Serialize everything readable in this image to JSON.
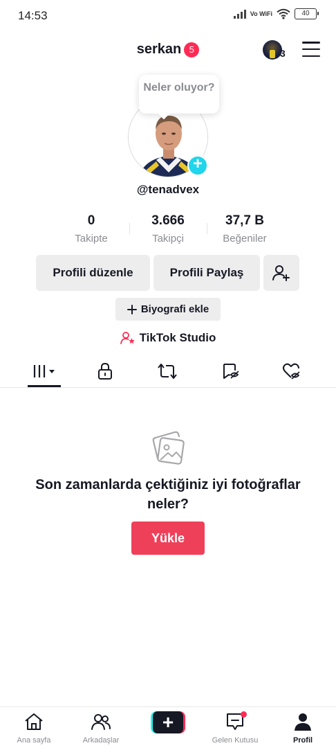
{
  "status_bar": {
    "time": "14:53",
    "network": "Vo WiFi",
    "battery": "40"
  },
  "header": {
    "username": "serkan",
    "notification_count": "5",
    "account_switch_count": "3"
  },
  "profile": {
    "note_bubble": "Neler oluyor?",
    "handle": "@tenadvex"
  },
  "stats": [
    {
      "value": "0",
      "label": "Takipte"
    },
    {
      "value": "3.666",
      "label": "Takipçi"
    },
    {
      "value": "37,7 B",
      "label": "Beğeniler"
    }
  ],
  "actions": {
    "edit_profile": "Profili düzenle",
    "share_profile": "Profili Paylaş",
    "add_bio": "Biyografi ekle",
    "studio": "TikTok Studio"
  },
  "tabs": [
    "videos-grid",
    "private",
    "reposts",
    "favorites",
    "liked"
  ],
  "empty_state": {
    "title": "Son zamanlarda çektiğiniz iyi fotoğraflar neler?",
    "upload_button": "Yükle"
  },
  "bottom_nav": {
    "home": "Ana sayfa",
    "friends": "Arkadaşlar",
    "inbox": "Gelen Kutusu",
    "profile": "Profil"
  },
  "colors": {
    "accent": "#fe2c55",
    "upload_button": "#ef405a",
    "cyan": "#20d5ec",
    "text": "#161823",
    "muted": "#8a8b91"
  }
}
